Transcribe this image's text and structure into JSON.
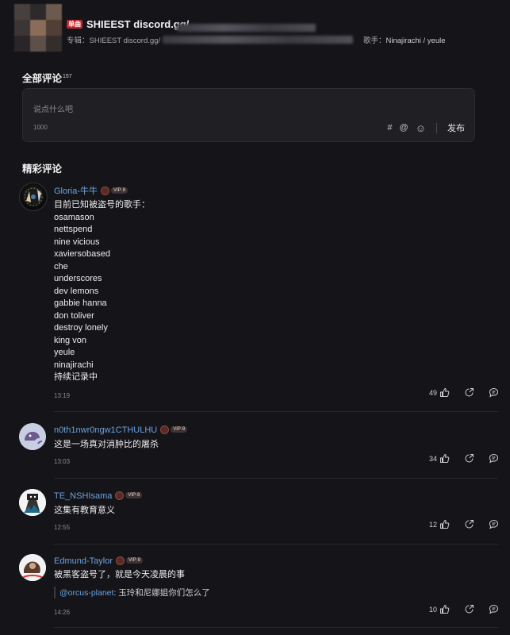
{
  "song": {
    "tag": "单曲",
    "title": "SHIEEST discord.gg/",
    "album_label": "专辑：",
    "album": "SHIEEST discord.gg/",
    "singer_label": "歌手：",
    "singer": "Ninajirachi / yeule"
  },
  "comments_section": {
    "title": "全部评论",
    "count": "157",
    "placeholder": "说点什么吧",
    "char_limit": "1000",
    "tool_icons": [
      "hash-icon",
      "at-icon",
      "emoji-icon"
    ],
    "tool_hash": "#",
    "tool_at": "@",
    "tool_emoji": "☺",
    "send_label": "发布"
  },
  "featured": {
    "title": "精彩评论",
    "comments": [
      {
        "user": "Gloria-牛牛",
        "vip": "VIP·8",
        "text": "目前已知被盗号的歌手：\nosamason\nnettspend\nnine vicious\nxaviersobased\nche\nunderscores\ndev lemons\ngabbie hanna\ndon toliver\ndestroy lonely\nking von\nyeule\nninajirachi\n持续记录中",
        "time": "13:19",
        "likes": "49"
      },
      {
        "user": "n0th1nwr0ngw1CTHULHU",
        "vip": "VIP·8",
        "text": "这是一场真对消肿比的屠杀",
        "time": "13:03",
        "likes": "34"
      },
      {
        "user": "TE_NSHIsama",
        "vip": "VIP·8",
        "text": "这集有教育意义",
        "time": "12:55",
        "likes": "12"
      },
      {
        "user": "Edmund-Taylor",
        "vip": "VIP·8",
        "text": "被黑客盗号了，就是今天凌晨的事",
        "reply_at": "@orcus-planet",
        "reply_text": ": 玉玲和尼娜姐你们怎么了",
        "time": "14:26",
        "likes": "10"
      }
    ]
  }
}
